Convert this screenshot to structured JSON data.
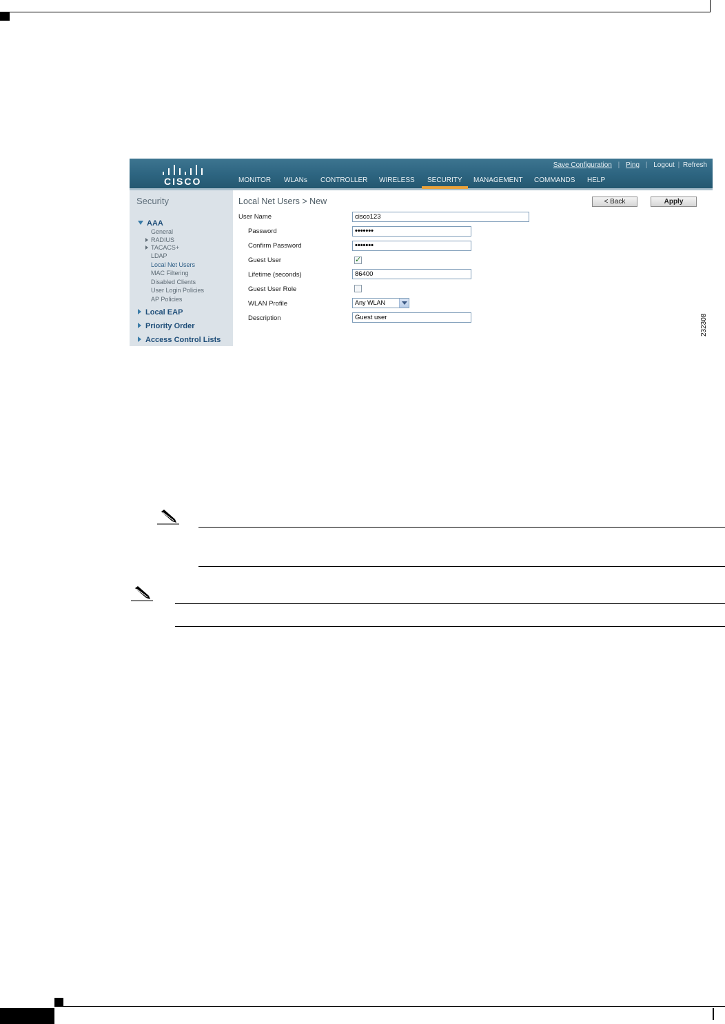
{
  "screenshot": {
    "brand": "CISCO",
    "utility_links": [
      "Save Configuration",
      "Ping",
      "Logout",
      "Refresh"
    ],
    "menu": [
      {
        "label": "MONITOR",
        "active": false
      },
      {
        "label": "WLANs",
        "active": false
      },
      {
        "label": "CONTROLLER",
        "active": false
      },
      {
        "label": "WIRELESS",
        "active": false
      },
      {
        "label": "SECURITY",
        "active": true
      },
      {
        "label": "MANAGEMENT",
        "active": false
      },
      {
        "label": "COMMANDS",
        "active": false
      },
      {
        "label": "HELP",
        "active": false
      }
    ],
    "sidebar": {
      "title": "Security",
      "groups": [
        {
          "label": "AAA",
          "expanded": true,
          "items": [
            "General",
            "RADIUS",
            "TACACS+",
            "LDAP",
            "Local Net Users",
            "MAC Filtering",
            "Disabled Clients",
            "User Login Policies",
            "AP Policies"
          ]
        },
        {
          "label": "Local EAP",
          "expanded": false
        },
        {
          "label": "Priority Order",
          "expanded": false
        },
        {
          "label": "Access Control Lists",
          "expanded": false
        }
      ],
      "active_item": "Local Net Users"
    },
    "page_title": "Local Net Users > New",
    "buttons": {
      "back": "< Back",
      "apply": "Apply"
    },
    "form": {
      "user_name": {
        "label": "User Name",
        "value": "cisco123"
      },
      "password": {
        "label": "Password",
        "value": "•••••••"
      },
      "confirm_password": {
        "label": "Confirm Password",
        "value": "•••••••"
      },
      "guest_user": {
        "label": "Guest User",
        "checked": true
      },
      "lifetime": {
        "label": "Lifetime (seconds)",
        "value": "86400"
      },
      "guest_user_role": {
        "label": "Guest User Role",
        "checked": false
      },
      "wlan_profile": {
        "label": "WLAN Profile",
        "value": "Any WLAN"
      },
      "description": {
        "label": "Description",
        "value": "Guest user"
      }
    },
    "figure_number": "232308"
  },
  "colors": {
    "header": "#2d6480",
    "sidebar": "#dbe2e8",
    "active_tab": "#e9a23b",
    "link": "#1f4e79"
  }
}
